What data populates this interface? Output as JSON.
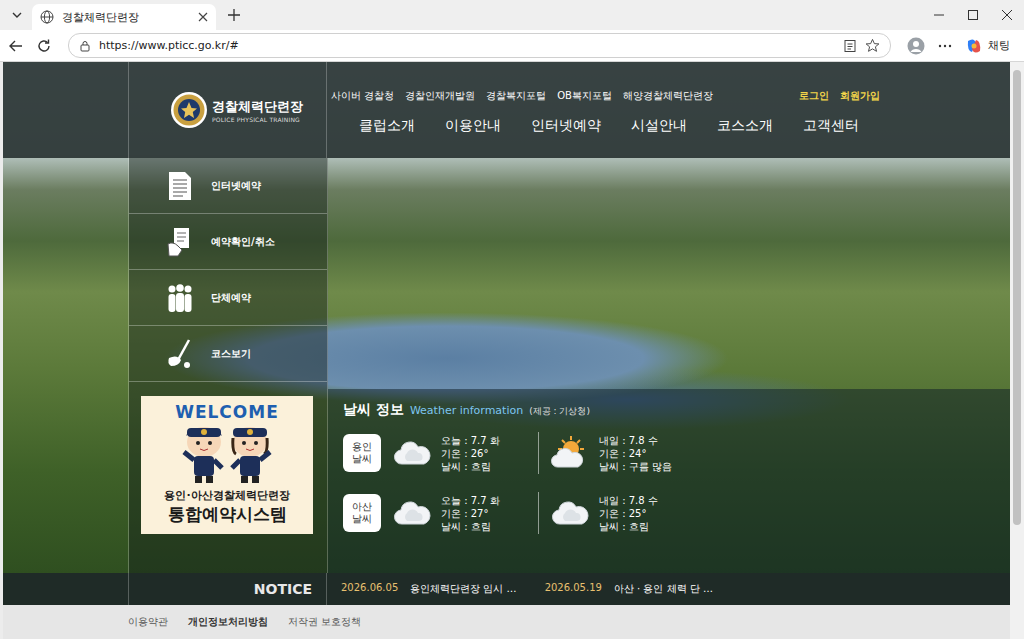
{
  "window": {
    "tab": {
      "title": "경찰체력단련장",
      "selected": true
    },
    "address": "https://www.pticc.go.kr/#",
    "chat_button": "채팅"
  },
  "site": {
    "logo": {
      "title": "경찰체력단련장",
      "subtitle": "POLICE PHYSICAL TRAINING"
    },
    "top_links": [
      "사이버 경찰청",
      "경찰인재개발원",
      "경찰복지포털",
      "OB복지포털",
      "해양경찰체력단련장"
    ],
    "account_links": [
      "로그인",
      "회원가입"
    ],
    "nav": [
      "클럽소개",
      "이용안내",
      "인터넷예약",
      "시설안내",
      "코스소개",
      "고객센터"
    ],
    "sidebar": [
      "인터넷예약",
      "예약확인/취소",
      "단체예약",
      "코스보기"
    ],
    "banner": {
      "greeting": "WELCOME",
      "line1": "용인·아산경찰체력단련장",
      "line2": "통합예약시스템"
    },
    "weather": {
      "title": "날씨 정보",
      "subtitle": "Weather information",
      "source": "(제공 : 기상청)",
      "locations": [
        {
          "label_lines": [
            "용인",
            "날씨"
          ],
          "forecasts": [
            {
              "kind": "cloud",
              "lines": [
                "오늘 : 7.7 화",
                "기온 : 26°",
                "날씨 : 흐림"
              ]
            },
            {
              "kind": "partly-cloudy",
              "lines": [
                "내일 : 7.8 수",
                "기온 : 24°",
                "날씨 : 구름 많음"
              ]
            }
          ]
        },
        {
          "label_lines": [
            "아산",
            "날씨"
          ],
          "forecasts": [
            {
              "kind": "cloud",
              "lines": [
                "오늘 : 7.7 화",
                "기온 : 27°",
                "날씨 : 흐림"
              ]
            },
            {
              "kind": "cloud",
              "lines": [
                "내일 : 7.8 수",
                "기온 : 25°",
                "날씨 : 흐림"
              ]
            }
          ]
        }
      ]
    },
    "notice": {
      "label": "NOTICE",
      "items": [
        {
          "date": "2026.06.05",
          "title": "용인체력단련장 임시 …"
        },
        {
          "date": "2026.05.19",
          "title": "아산 · 용인 체력 단 …"
        }
      ]
    },
    "footer": [
      {
        "label": "이용약관",
        "emphasized": false
      },
      {
        "label": "개인정보처리방침",
        "emphasized": true
      },
      {
        "label": "저작권 보호정책",
        "emphasized": false
      }
    ]
  }
}
